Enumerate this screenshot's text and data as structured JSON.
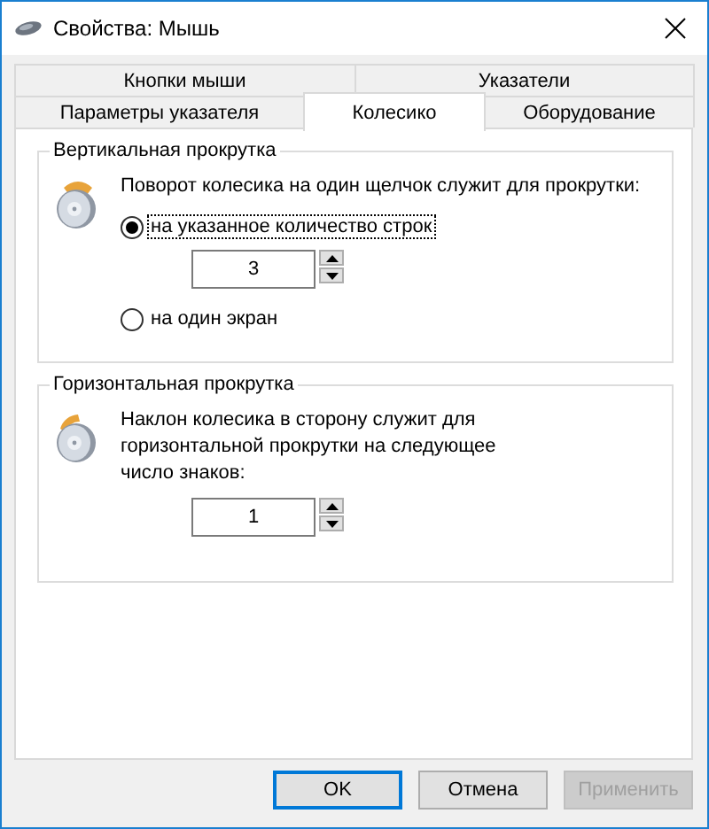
{
  "window": {
    "title": "Свойства: Мышь"
  },
  "tabs": [
    [
      {
        "label": "Кнопки мыши",
        "selected": false
      },
      {
        "label": "Указатели",
        "selected": false
      }
    ],
    [
      {
        "label": "Параметры указателя",
        "selected": false
      },
      {
        "label": "Колесико",
        "selected": true
      },
      {
        "label": "Оборудование",
        "selected": false
      }
    ]
  ],
  "groups": [
    {
      "title": "Вертикальная прокрутка",
      "items": [
        {
          "kind": "text",
          "text": "Поворот колесика на один щелчок служит для прокрутки:"
        },
        {
          "kind": "radio",
          "label": "на указанное количество строк",
          "selected": true,
          "focused": true
        },
        {
          "kind": "spinner",
          "value": "3"
        },
        {
          "kind": "radio",
          "label": "на один экран",
          "selected": false,
          "focused": false
        }
      ]
    },
    {
      "title": "Горизонтальная прокрутка",
      "items": [
        {
          "kind": "text",
          "text": "Наклон колесика в сторону служит для горизонтальной прокрутки на следующее число знаков:"
        },
        {
          "kind": "spinner",
          "value": "1"
        }
      ]
    }
  ],
  "buttons": [
    {
      "label": "OK",
      "default": true,
      "disabled": false
    },
    {
      "label": "Отмена",
      "default": false,
      "disabled": false
    },
    {
      "label": "Применить",
      "default": false,
      "disabled": true
    }
  ]
}
